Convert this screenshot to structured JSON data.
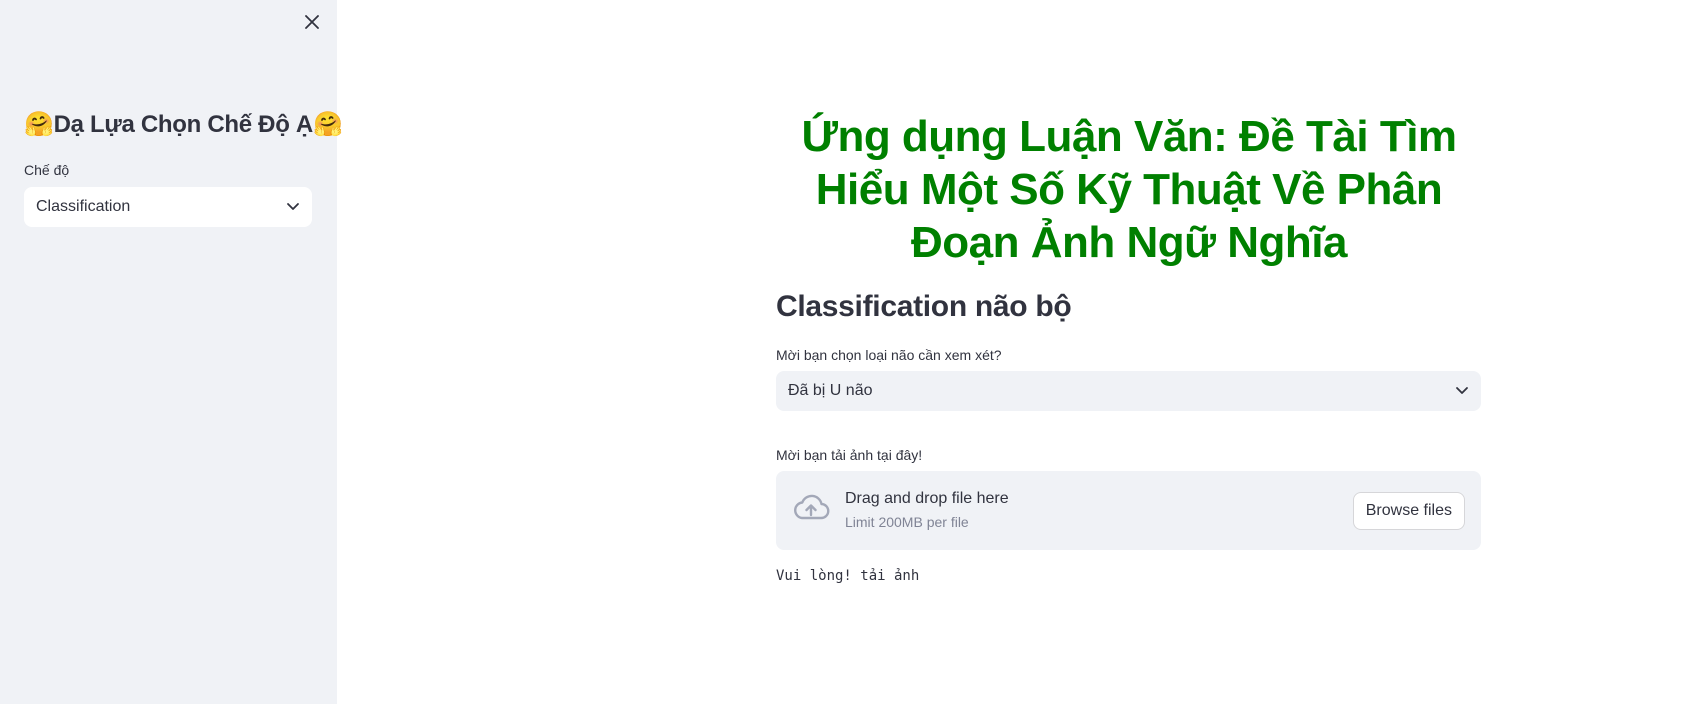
{
  "sidebar": {
    "title": "🤗Dạ Lựa Chọn Chế Độ Ạ🤗",
    "mode_label": "Chế độ",
    "mode_value": "Classification"
  },
  "main": {
    "title": "Ứng dụng Luận Văn: Đề Tài Tìm Hiểu Một Số Kỹ Thuật Về Phân Đoạn Ảnh Ngữ Nghĩa",
    "subheader": "Classification não bộ",
    "brain_select_label": "Mời bạn chọn loại não cần xem xét?",
    "brain_select_value": "Đã bị U não",
    "upload_label": "Mời bạn tải ảnh tại đây!",
    "upload": {
      "drag_text": "Drag and drop file here",
      "limit_text": "Limit 200MB per file",
      "browse_label": "Browse files"
    },
    "status_text": "Vui lòng! tải ảnh"
  },
  "colors": {
    "title_green": "#008000",
    "sidebar_bg": "#f0f2f6",
    "text": "#31333f"
  }
}
